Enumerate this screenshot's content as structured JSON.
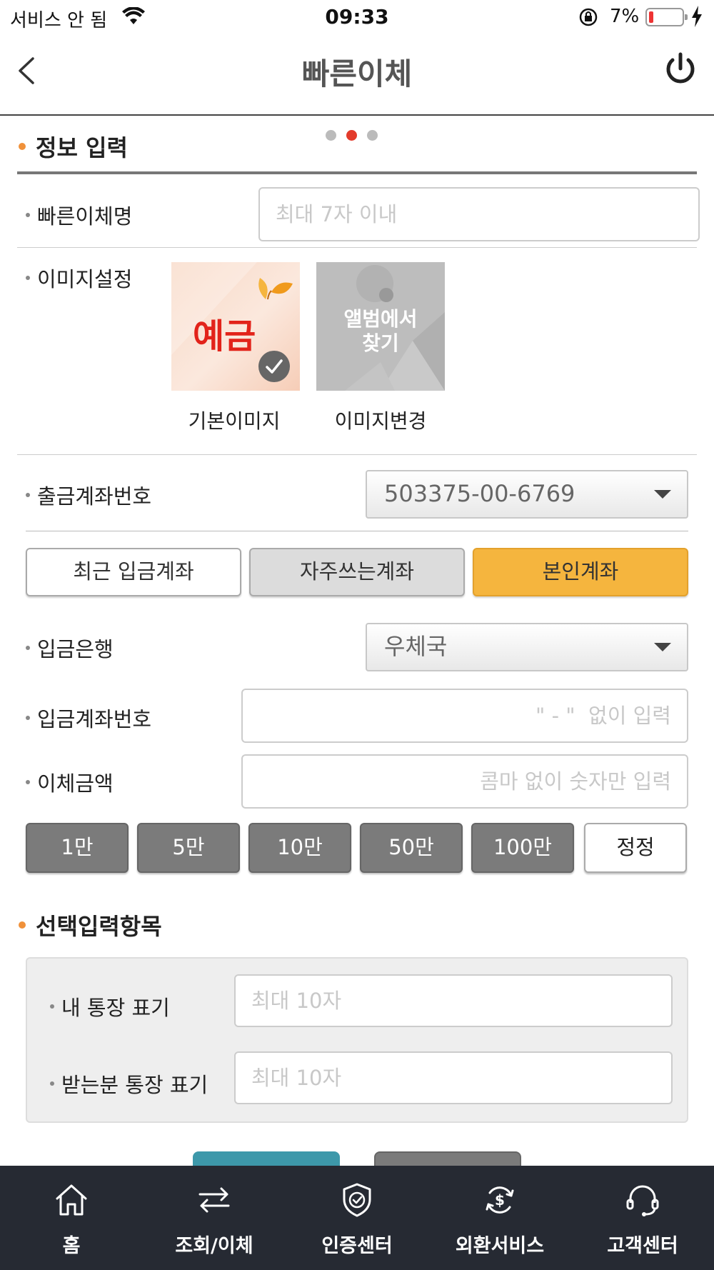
{
  "status_bar": {
    "carrier": "서비스 안 됨",
    "time": "09:33",
    "battery_pct": "7%"
  },
  "header": {
    "title": "빠른이체"
  },
  "pager": {
    "total": 3,
    "active_index": 1
  },
  "info_section": {
    "title": "정보 입력",
    "name_label": "빠른이체명",
    "name_placeholder": "최대 7자 이내",
    "image_label": "이미지설정",
    "default_image": {
      "art_text": "예금",
      "caption": "기본이미지"
    },
    "change_image": {
      "art_text_line1": "앨범에서",
      "art_text_line2": "찾기",
      "caption": "이미지변경"
    },
    "withdraw_label": "출금계좌번호",
    "withdraw_value": "503375-00-6769",
    "tabs": [
      "최근 입금계좌",
      "자주쓰는계좌",
      "본인계좌"
    ],
    "bank_label": "입금은행",
    "bank_value": "우체국",
    "deposit_label": "입금계좌번호",
    "deposit_placeholder": "\" - \"  없이 입력",
    "amount_label": "이체금액",
    "amount_placeholder": "콤마 없이 숫자만 입력",
    "amount_buttons": [
      "1만",
      "5만",
      "10만",
      "50만",
      "100만",
      "정정"
    ]
  },
  "optional_section": {
    "title": "선택입력항목",
    "my_memo_label": "내 통장 표기",
    "my_memo_placeholder": "최대 10자",
    "recipient_memo_label": "받는분 통장 표기",
    "recipient_memo_placeholder": "최대 10자"
  },
  "colors": {
    "accent_orange": "#f5b53e",
    "dot_orange": "#f0913a",
    "pager_active": "#e33b2b",
    "tabbar_bg": "#262a33",
    "confirm_teal": "#3d98aa"
  },
  "tabbar": [
    {
      "label": "홈",
      "icon": "home-icon"
    },
    {
      "label": "조회/이체",
      "icon": "transfer-arrows-icon"
    },
    {
      "label": "인증센터",
      "icon": "shield-check-icon"
    },
    {
      "label": "외환서비스",
      "icon": "currency-exchange-icon"
    },
    {
      "label": "고객센터",
      "icon": "headset-icon"
    }
  ]
}
